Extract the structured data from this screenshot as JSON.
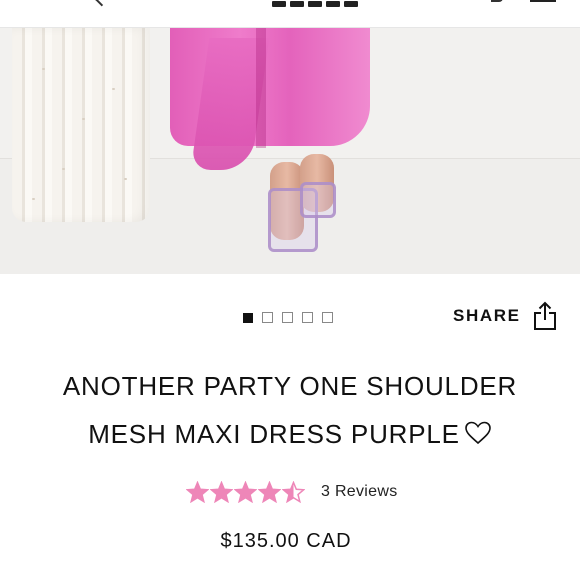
{
  "gallery": {
    "slide_count": 5,
    "active_slide": 1
  },
  "share": {
    "label": "SHARE"
  },
  "product": {
    "title_line1": "ANOTHER PARTY ONE SHOULDER",
    "title_line2": "MESH MAXI DRESS PURPLE",
    "rating_stars": 4.5,
    "reviews_text": "3 Reviews",
    "price": "$135.00 CAD"
  },
  "colors": {
    "star": "#ee86b8",
    "text": "#111111",
    "dress_pink": "#e86cc2"
  },
  "icons": {
    "share": "share-upload-icon",
    "wishlist": "heart-outline-icon",
    "rating": "star-icon"
  }
}
